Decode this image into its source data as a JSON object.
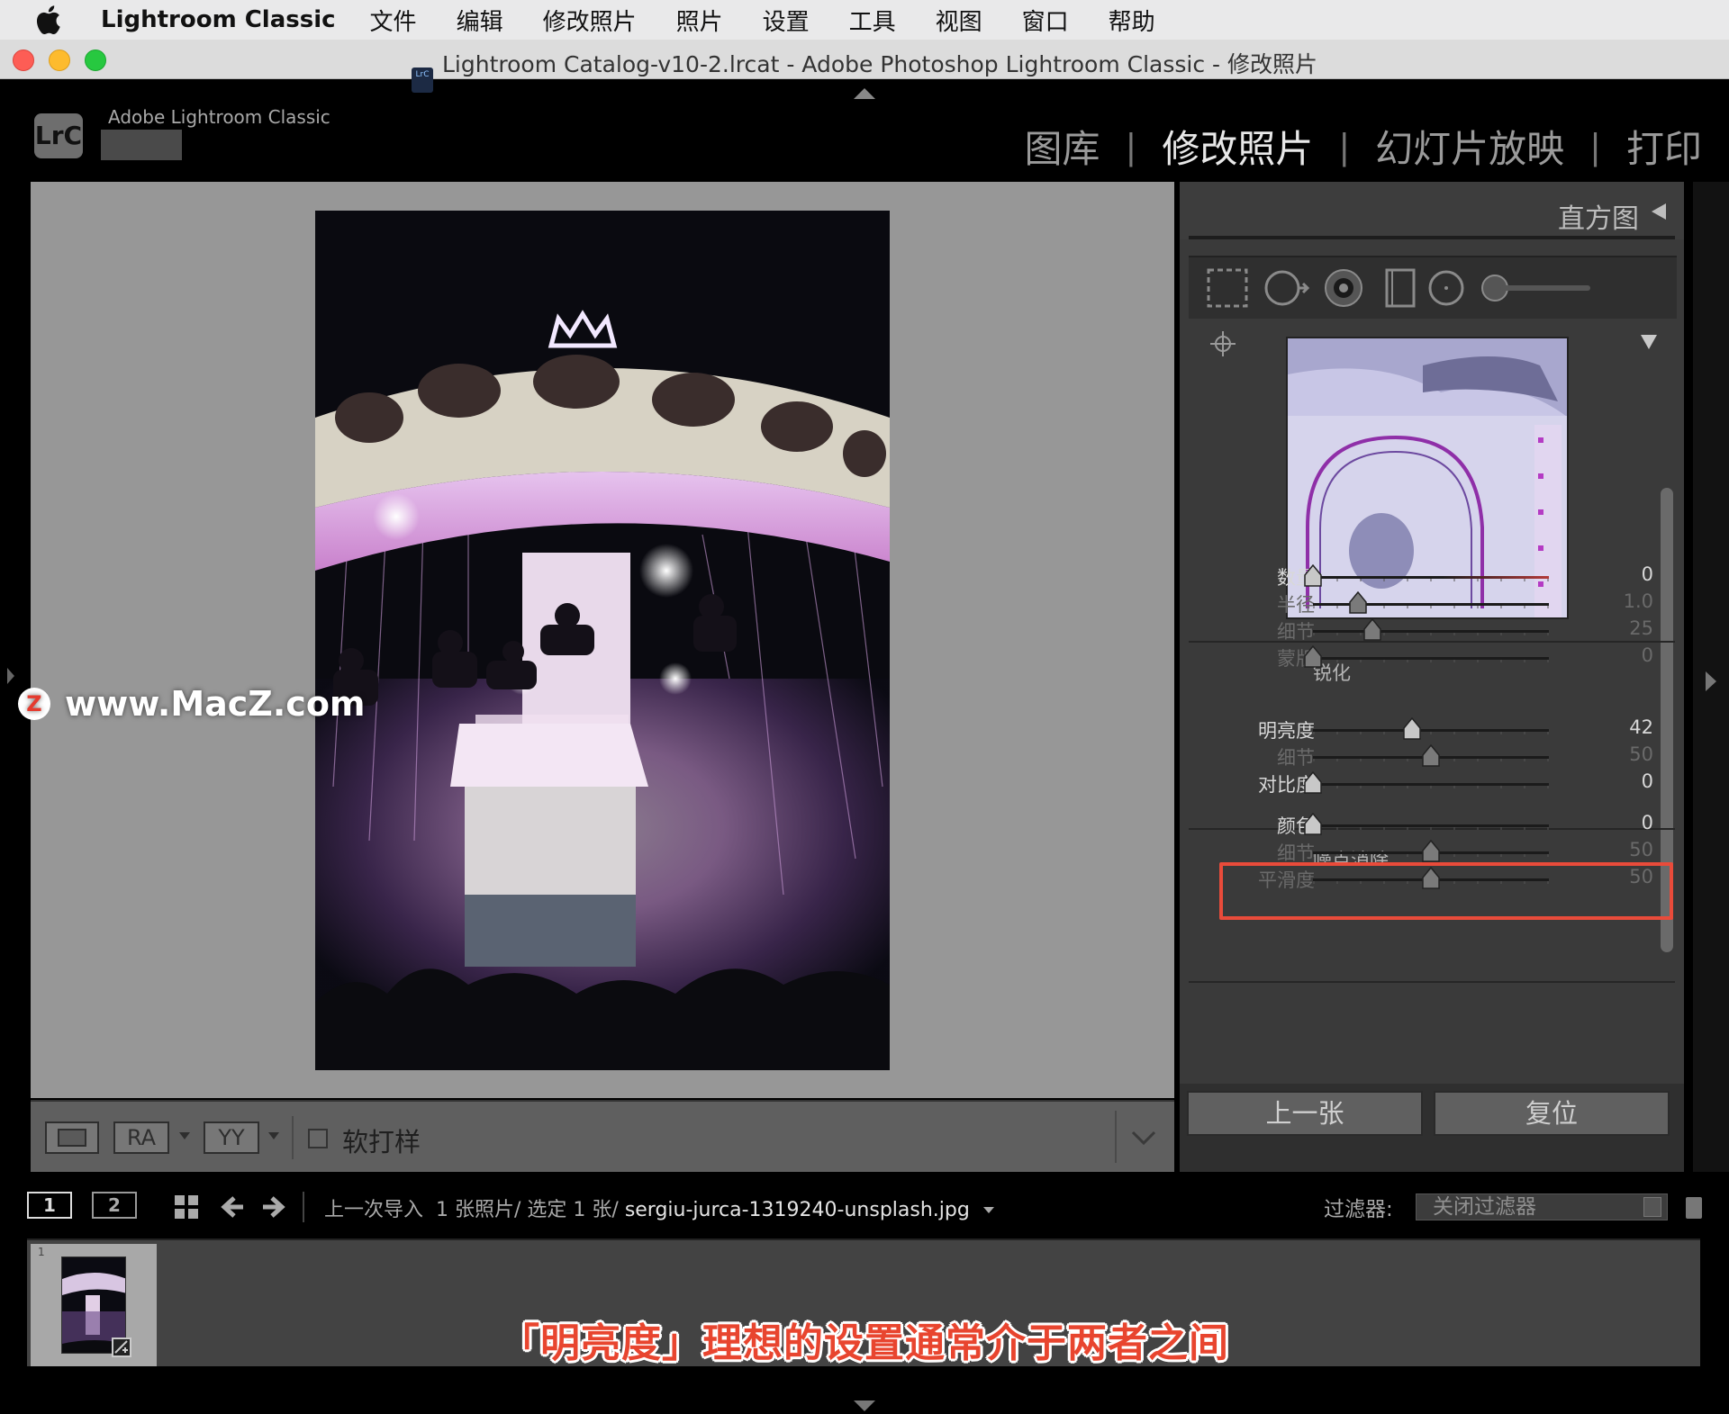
{
  "menubar": {
    "app_name": "Lightroom Classic",
    "items": [
      "文件",
      "编辑",
      "修改照片",
      "照片",
      "设置",
      "工具",
      "视图",
      "窗口",
      "帮助"
    ]
  },
  "window": {
    "title": "Lightroom Catalog-v10-2.lrcat - Adobe Photoshop Lightroom Classic - 修改照片",
    "doc_icon_text": "LrC"
  },
  "identity": {
    "logo_text": "LrC",
    "brand": "Adobe Lightroom Classic"
  },
  "modules": [
    "图库",
    "修改照片",
    "幻灯片放映",
    "打印"
  ],
  "active_module": "修改照片",
  "watermark": {
    "logo_text": "Z",
    "text": "www.MacZ.com"
  },
  "toolbar": {
    "ra_label": "RA",
    "yy_label": "YY",
    "soft_proof_label": "软打样"
  },
  "panel": {
    "histogram_label": "直方图",
    "sharpening": {
      "title": "锐化",
      "sliders": [
        {
          "label": "数量",
          "value": "0",
          "pos": 0.0,
          "enabled": true
        },
        {
          "label": "半径",
          "value": "1.0",
          "pos": 0.19,
          "enabled": false
        },
        {
          "label": "细节",
          "value": "25",
          "pos": 0.25,
          "enabled": false
        },
        {
          "label": "蒙版",
          "value": "0",
          "pos": 0.0,
          "enabled": false
        }
      ]
    },
    "noise_reduction": {
      "title": "噪点消除",
      "sliders": [
        {
          "label": "明亮度",
          "value": "42",
          "pos": 0.42,
          "enabled": true
        },
        {
          "label": "细节",
          "value": "50",
          "pos": 0.5,
          "enabled": false
        },
        {
          "label": "对比度",
          "value": "0",
          "pos": 0.0,
          "enabled": true
        }
      ]
    },
    "color_sliders": [
      {
        "label": "颜色",
        "value": "0",
        "pos": 0.0,
        "enabled": true
      },
      {
        "label": "细节",
        "value": "50",
        "pos": 0.5,
        "enabled": false
      },
      {
        "label": "平滑度",
        "value": "50",
        "pos": 0.5,
        "enabled": false
      }
    ],
    "prev_button": "上一张",
    "reset_button": "复位"
  },
  "filmstrip_bar": {
    "view1": "1",
    "view2": "2",
    "source": "上一次导入",
    "count": "1 张照片/ 选定 1 张/",
    "filename": "sergiu-jurca-1319240-unsplash.jpg",
    "filter_label": "过滤器:",
    "filter_value": "关闭过滤器"
  },
  "filmstrip": {
    "thumb_index": "1"
  },
  "caption": "「明亮度」理想的设置通常介于两者之间",
  "colors": {
    "highlight": "#e94b3a",
    "caption": "#e8452f",
    "view_bg": "#979797"
  }
}
